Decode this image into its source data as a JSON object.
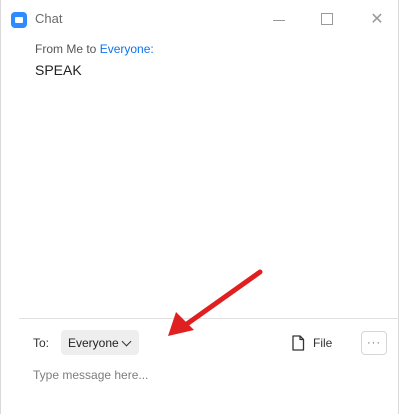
{
  "window": {
    "title": "Chat",
    "controls": {
      "minimize": "—",
      "maximize": "☐",
      "close": "✕"
    }
  },
  "message": {
    "from_prefix": "From Me to ",
    "to": "Everyone:",
    "text": "SPEAK"
  },
  "composer": {
    "to_label": "To:",
    "recipient": "Everyone",
    "file_label": "File",
    "more_label": "···",
    "placeholder": "Type message here..."
  },
  "colors": {
    "accent": "#0e72ed",
    "app_icon": "#2d8cff",
    "annotation_arrow": "#e02020"
  }
}
